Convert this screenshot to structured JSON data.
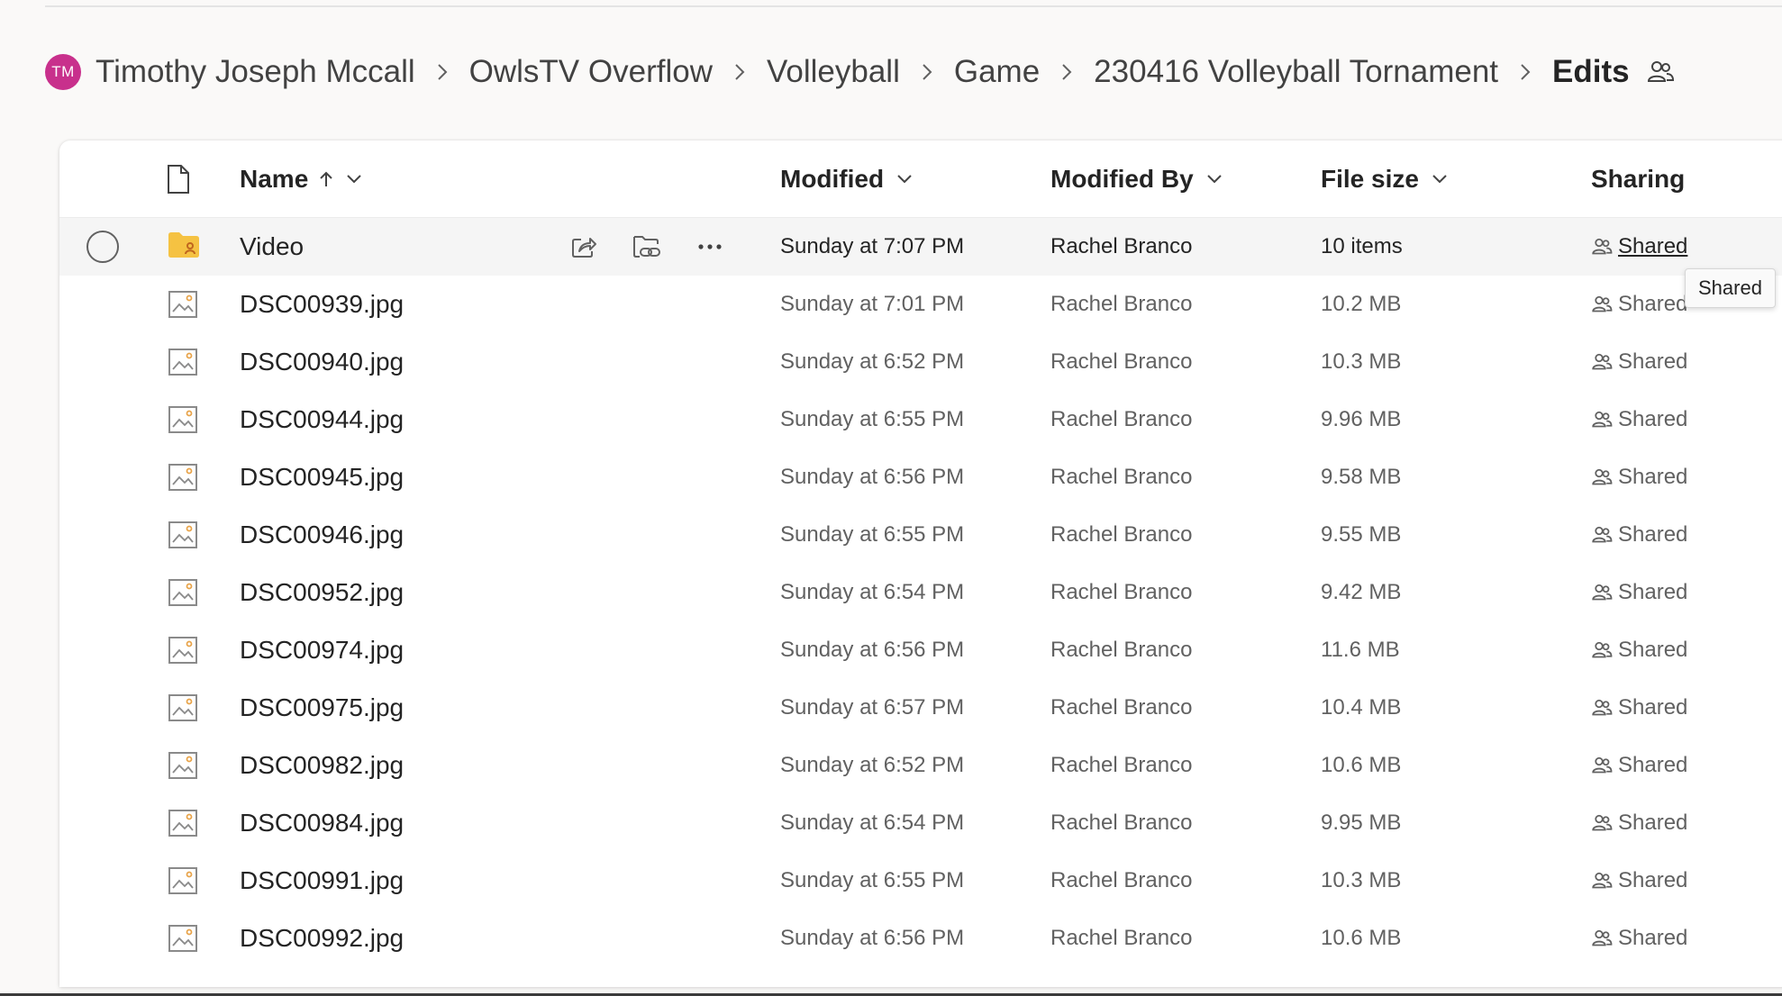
{
  "breadcrumb": {
    "avatar_initials": "TM",
    "items": [
      "Timothy Joseph Mccall",
      "OwlsTV Overflow",
      "Volleyball",
      "Game",
      "230416 Volleyball Tornament"
    ],
    "current": "Edits",
    "current_icon": "people-icon"
  },
  "columns": {
    "name": "Name",
    "modified": "Modified",
    "modified_by": "Modified By",
    "file_size": "File size",
    "sharing": "Sharing",
    "name_sort": "ascending"
  },
  "rows": [
    {
      "name": "Video",
      "type": "shared-folder",
      "modified": "Sunday at 7:07 PM",
      "modified_by": "Rachel Branco",
      "size": "10 items",
      "sharing": "Shared"
    },
    {
      "name": "DSC00939.jpg",
      "type": "image",
      "modified": "Sunday at 7:01 PM",
      "modified_by": "Rachel Branco",
      "size": "10.2 MB",
      "sharing": "Shared"
    },
    {
      "name": "DSC00940.jpg",
      "type": "image",
      "modified": "Sunday at 6:52 PM",
      "modified_by": "Rachel Branco",
      "size": "10.3 MB",
      "sharing": "Shared"
    },
    {
      "name": "DSC00944.jpg",
      "type": "image",
      "modified": "Sunday at 6:55 PM",
      "modified_by": "Rachel Branco",
      "size": "9.96 MB",
      "sharing": "Shared"
    },
    {
      "name": "DSC00945.jpg",
      "type": "image",
      "modified": "Sunday at 6:56 PM",
      "modified_by": "Rachel Branco",
      "size": "9.58 MB",
      "sharing": "Shared"
    },
    {
      "name": "DSC00946.jpg",
      "type": "image",
      "modified": "Sunday at 6:55 PM",
      "modified_by": "Rachel Branco",
      "size": "9.55 MB",
      "sharing": "Shared"
    },
    {
      "name": "DSC00952.jpg",
      "type": "image",
      "modified": "Sunday at 6:54 PM",
      "modified_by": "Rachel Branco",
      "size": "9.42 MB",
      "sharing": "Shared"
    },
    {
      "name": "DSC00974.jpg",
      "type": "image",
      "modified": "Sunday at 6:56 PM",
      "modified_by": "Rachel Branco",
      "size": "11.6 MB",
      "sharing": "Shared"
    },
    {
      "name": "DSC00975.jpg",
      "type": "image",
      "modified": "Sunday at 6:57 PM",
      "modified_by": "Rachel Branco",
      "size": "10.4 MB",
      "sharing": "Shared"
    },
    {
      "name": "DSC00982.jpg",
      "type": "image",
      "modified": "Sunday at 6:52 PM",
      "modified_by": "Rachel Branco",
      "size": "10.6 MB",
      "sharing": "Shared"
    },
    {
      "name": "DSC00984.jpg",
      "type": "image",
      "modified": "Sunday at 6:54 PM",
      "modified_by": "Rachel Branco",
      "size": "9.95 MB",
      "sharing": "Shared"
    },
    {
      "name": "DSC00991.jpg",
      "type": "image",
      "modified": "Sunday at 6:55 PM",
      "modified_by": "Rachel Branco",
      "size": "10.3 MB",
      "sharing": "Shared"
    },
    {
      "name": "DSC00992.jpg",
      "type": "image",
      "modified": "Sunday at 6:56 PM",
      "modified_by": "Rachel Branco",
      "size": "10.6 MB",
      "sharing": "Shared"
    }
  ],
  "hovered_row_actions": [
    "share-icon",
    "copy-link-icon",
    "more-options-icon"
  ],
  "tooltip": "Shared",
  "colors": {
    "avatar": "#c8308c",
    "folder": "#f5c242",
    "folder_badge": "#c0661e",
    "image_accent": "#e8a44a"
  }
}
